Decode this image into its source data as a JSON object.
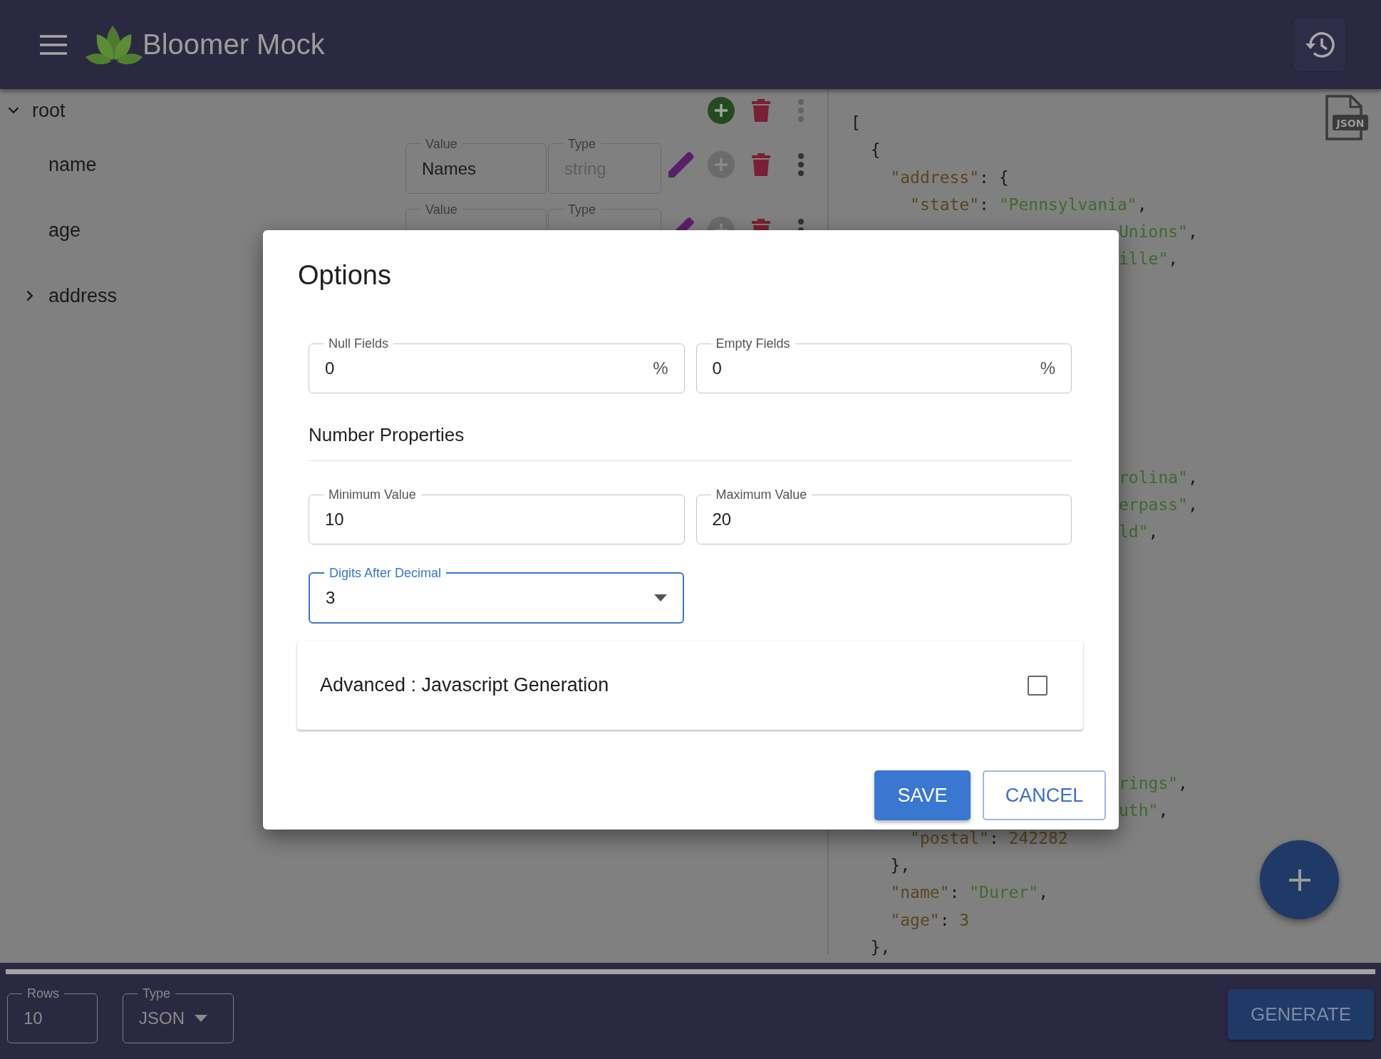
{
  "app_bar": {
    "title": "Bloomer Mock"
  },
  "tree": [
    {
      "kind": "object",
      "label": "root",
      "expanded": true,
      "children": [
        {
          "kind": "field",
          "label": "name",
          "value_label": "Value",
          "value": "Names",
          "type_label": "Type",
          "type": "string"
        },
        {
          "kind": "field",
          "label": "age",
          "value_label": "Value",
          "type_label": "Type"
        },
        {
          "kind": "object",
          "label": "address",
          "expanded": false
        }
      ]
    }
  ],
  "code_preview": {
    "file_badge": "JSON",
    "blocks": [
      {
        "lines": [
          {
            "text": "[",
            "kind": "code"
          },
          {
            "text": "  {",
            "kind": "code"
          },
          {
            "text": "    \"address\": {",
            "kind": "code"
          },
          {
            "text": "      \"state\": \"Pennsylvania\",",
            "kind": "code"
          },
          {
            "text": "Unions\",",
            "kind": "fragment"
          },
          {
            "text": "ille\",",
            "kind": "fragment"
          }
        ]
      },
      {
        "lines": [
          {
            "text": "rolina\",",
            "kind": "fragment"
          },
          {
            "text": "erpass\",",
            "kind": "fragment"
          },
          {
            "text": "ld\",",
            "kind": "fragment"
          }
        ]
      },
      {
        "lines": [
          {
            "text": "rings\",",
            "kind": "fragment"
          },
          {
            "text": "uth\",",
            "kind": "fragment"
          },
          {
            "text": "      \"postal\": 242282",
            "kind": "code"
          },
          {
            "text": "    },",
            "kind": "code"
          },
          {
            "text": "    \"name\": \"Durer\",",
            "kind": "code"
          },
          {
            "text": "    \"age\": 3",
            "kind": "code"
          },
          {
            "text": "  },",
            "kind": "code"
          }
        ]
      }
    ]
  },
  "dialog": {
    "title": "Options",
    "percent_fields": [
      {
        "label": "Null Fields",
        "value": "0",
        "suffix": "%"
      },
      {
        "label": "Empty Fields",
        "value": "0",
        "suffix": "%"
      }
    ],
    "section_title": "Number Properties",
    "number_fields": [
      {
        "label": "Minimum Value",
        "value": "10"
      },
      {
        "label": "Maximum Value",
        "value": "20"
      }
    ],
    "select": {
      "label": "Digits After Decimal",
      "value": "3",
      "focused": true
    },
    "advanced": {
      "label": "Advanced : Javascript Generation",
      "checked": false
    },
    "buttons": [
      {
        "label": "SAVE",
        "kind": "contained"
      },
      {
        "label": "CANCEL",
        "kind": "outlined"
      }
    ]
  },
  "footer": {
    "progress": {
      "level": 1
    },
    "rows": {
      "label": "Rows",
      "value": "10"
    },
    "type": {
      "label": "Type",
      "value": "JSON"
    },
    "generate": "GENERATE"
  }
}
